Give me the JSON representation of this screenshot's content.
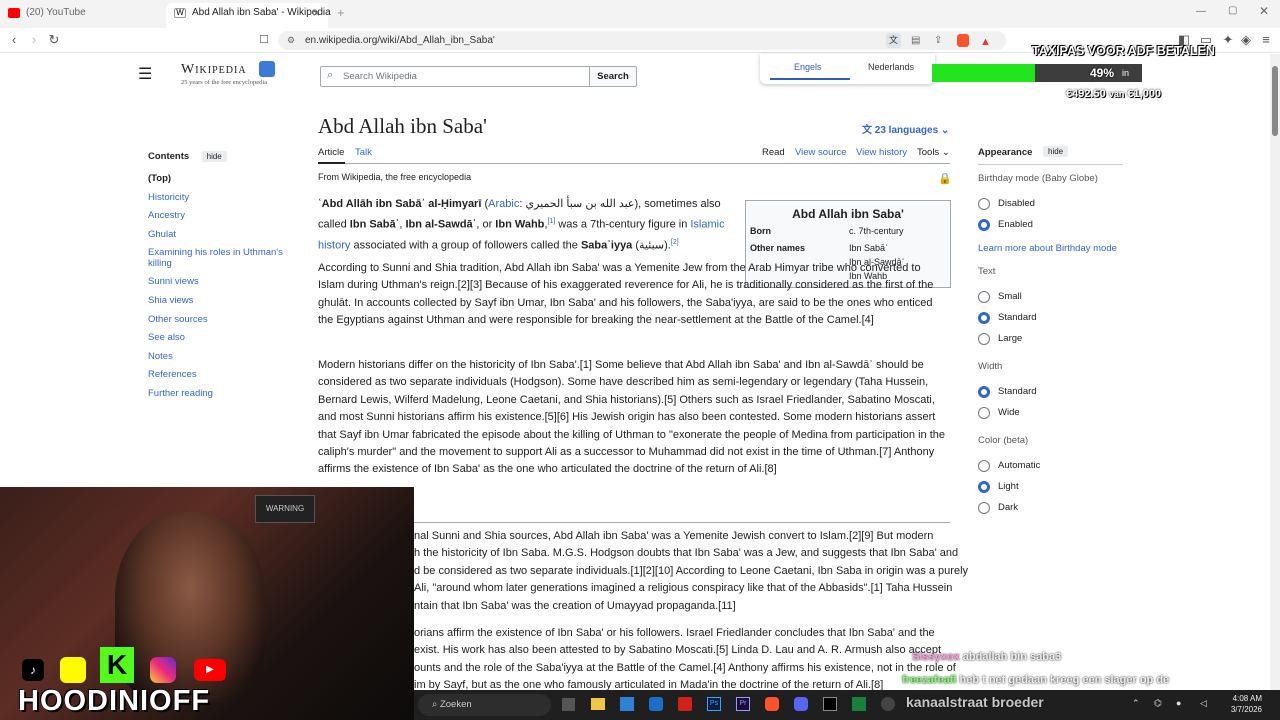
{
  "browser": {
    "tabs": [
      {
        "label": "(20) YouTube"
      },
      {
        "label": "Abd Allah ibn Saba' - Wikipedia"
      }
    ],
    "url": "en.wikipedia.org/wiki/Abd_Allah_ibn_Saba'"
  },
  "translate_popup": {
    "lang1": "Engels",
    "lang2": "Nederlands"
  },
  "stream_overlay": {
    "goal_title": "TAXIPAS VOOR ADF BETALEN",
    "percent": "49%",
    "percent_suffix": "in",
    "amount": "€492.50",
    "amount_of": "van",
    "goal": "€1,000",
    "progress": 0.49
  },
  "wiki": {
    "logo_title": "Wikipedia",
    "logo_sub": "25 years of the free encyclopedia",
    "search_placeholder": "Search Wikipedia",
    "search_button": "Search",
    "title": "Abd Allah ibn Saba'",
    "languages": "23 languages",
    "tabs": {
      "article": "Article",
      "talk": "Talk",
      "read": "Read",
      "view_source": "View source",
      "view_history": "View history",
      "tools": "Tools"
    },
    "from": "From Wikipedia, the free encyclopedia",
    "toc": {
      "heading": "Contents",
      "hide": "hide",
      "items": [
        "(Top)",
        "Historicity",
        "Ancestry",
        "Ghulat",
        "Examining his roles in Uthman's killing",
        "Sunni views",
        "Shia views",
        "Other sources",
        "See also",
        "Notes",
        "References",
        "Further reading"
      ]
    },
    "appearance": {
      "heading": "Appearance",
      "hide": "hide",
      "birthday_label": "Birthday mode (Baby Globe)",
      "birthday_opts": [
        "Disabled",
        "Enabled"
      ],
      "learn_more": "Learn more about Birthday mode",
      "text_label": "Text",
      "text_opts": [
        "Small",
        "Standard",
        "Large"
      ],
      "width_label": "Width",
      "width_opts": [
        "Standard",
        "Wide"
      ],
      "color_label": "Color (beta)",
      "color_opts": [
        "Automatic",
        "Light",
        "Dark"
      ]
    },
    "infobox": {
      "title": "Abd Allah ibn Saba'",
      "born_label": "Born",
      "born_value": "c. 7th-century",
      "other_label": "Other names",
      "other_values": [
        "Ibn Sabāʾ",
        "Ibn al-Sawdāʾ",
        "Ibn Wahb"
      ]
    },
    "p1": {
      "name": "ʿAbd Allāh ibn Sabāʾ al-Ḥimyarī",
      "arabic_label": "Arabic",
      "arabic": "عبد الله بن سبأ الحميري",
      "rest1": "), sometimes also called ",
      "alt1": "Ibn Sabāʾ",
      "alt2": "Ibn al-Sawdāʾ",
      "or": ", or ",
      "alt3": "Ibn Wahb",
      "sup1": "[1]",
      "rest2": " was a 7th-century figure in ",
      "link": "Islamic history",
      "line3a": "associated with a group of followers called the ",
      "sabaiyya": "Sabaʾiyya",
      "arabic2": "(سبئية)",
      "sup2": "[2]"
    },
    "paragraphs": [
      "According to Sunni and Shia tradition, Abd Allah ibn Saba' was a Yemenite Jew from the Arab Himyar tribe who converted to Islam during Uthman's reign.[2][3] Because of his exaggerated reverence for Ali, he is traditionally considered as the first of the ghulāt. In accounts collected by Sayf ibn Umar, Ibn Saba' and his followers, the Saba'iyya, are said to be the ones who enticed the Egyptians against Uthman and were responsible for breaking the near-settlement at the Battle of the Camel.[4]",
      "Modern historians differ on the historicity of Ibn Saba'.[1] Some believe that Abd Allah ibn Saba' and Ibn al-Sawdāʾ should be considered as two separate individuals (Hodgson). Some have described him as semi-legendary or legendary (Taha Hussein, Bernard Lewis, Wilferd Madelung, Leone Caetani, and Shia historians).[5] Others such as Israel Friedlander, Sabatino Moscati, and most Sunni historians affirm his existence.[5][6] His Jewish origin has also been contested. Some modern historians assert that Sayf ibn Umar fabricated the episode about the killing of Uthman to \"exonerate the people of Medina from participation in the caliph's murder\" and the movement to support Ali as a successor to Muhammad did not exist in the time of Uthman.[7] Anthony affirms the existence of Ibn Saba' as the one who articulated the doctrine of the return of Ali.[8]"
    ],
    "lower_lines": [
      "nal Sunni and Shia sources, Abd Allah ibn Saba' was a Yemenite Jewish convert to Islam.[2][9] But modern",
      "h the historicity of Ibn Saba. M.G.S. Hodgson doubts that Ibn Saba' was a Jew, and suggests that Ibn Saba' and",
      "d be considered as two separate individuals.[1][2][10] According to Leone Caetani, Ibn Saba in origin was a purely",
      "Ali, \"around whom later generations imagined a religious conspiracy like that of the Abbasids\".[1] Taha Hussein",
      "ntain that Ibn Saba' was the creation of Umayyad propaganda.[11]",
      "orians affirm the existence of Ibn Saba' or his followers. Israel Friedlander concludes that Ibn Saba' and the",
      "exist. His work has also been attested to by Sabatino Moscati.[5] Linda D. Lau and A. R. Armush also accept",
      "ounts and the role of the Saba'iyya at the Battle of the Camel.[4] Anthony affirms his existence, not in the role of",
      "im by Sayf, but as the one who famously articulated in Mada'in the doctrine of the return of Ali.[8]"
    ]
  },
  "webcam": {
    "name": "HOODINIOFF",
    "sign": "WARNING"
  },
  "chat": [
    {
      "user": "Sissyxox",
      "msg": "abdallah bin saba3"
    },
    {
      "user": "freezafeafi",
      "msg": "heb t net gedaan kreeg een slager op de"
    },
    {
      "user": "",
      "msg": "kanaalstraat broeder"
    }
  ],
  "taskbar": {
    "search": "Zoeken",
    "time": "4:08 AM",
    "date": "3/7/2026"
  }
}
